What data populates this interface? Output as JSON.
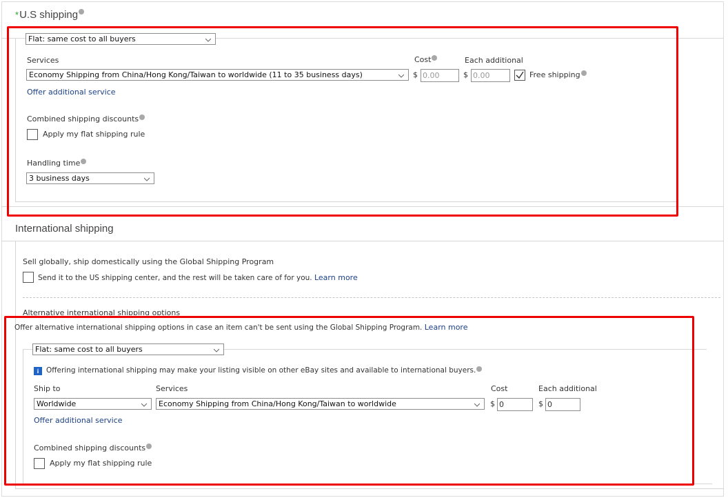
{
  "us_shipping": {
    "title": "U.S shipping",
    "required_marker": "*",
    "shipping_type": "Flat: same cost to all buyers",
    "services_label": "Services",
    "cost_label": "Cost",
    "each_additional_label": "Each additional",
    "service_value": "Economy Shipping from China/Hong Kong/Taiwan to worldwide (11 to 35 business days)",
    "currency": "$",
    "cost_value": "0.00",
    "each_additional_value": "0.00",
    "free_shipping_label": "Free shipping",
    "free_shipping_checked": true,
    "offer_additional_service": "Offer additional service",
    "combined_discounts_label": "Combined shipping discounts",
    "apply_flat_rule_label": "Apply my flat shipping rule",
    "handling_time_label": "Handling time",
    "handling_time_value": "3 business days"
  },
  "international_shipping": {
    "title": "International shipping",
    "gsp_heading": "Sell globally, ship domestically using the Global Shipping Program",
    "gsp_checkbox_label": "Send it to the US shipping center, and the rest will be taken care of for you.",
    "gsp_learn_more": "Learn more",
    "alt_heading": "Alternative international shipping options",
    "alt_description": "Offer alternative international shipping options in case an item can't be sent using the Global Shipping Program.",
    "alt_learn_more": "Learn more",
    "shipping_type": "Flat: same cost to all buyers",
    "info_icon": "i",
    "info_text": "Offering international shipping may make your listing visible on other eBay sites and available to international buyers.",
    "ship_to_label": "Ship to",
    "services_label": "Services",
    "cost_label": "Cost",
    "each_additional_label": "Each additional",
    "ship_to_value": "Worldwide",
    "service_value": "Economy Shipping from China/Hong Kong/Taiwan to worldwide",
    "currency": "$",
    "cost_value": "0",
    "each_additional_value": "0",
    "offer_additional_service": "Offer additional service",
    "combined_discounts_label": "Combined shipping discounts",
    "apply_flat_rule_label": "Apply my flat shipping rule"
  },
  "colors": {
    "highlight_border": "#ee0000",
    "link": "#1b3f86",
    "required_star": "#2aa52a",
    "info_icon": "#1e64c8"
  }
}
